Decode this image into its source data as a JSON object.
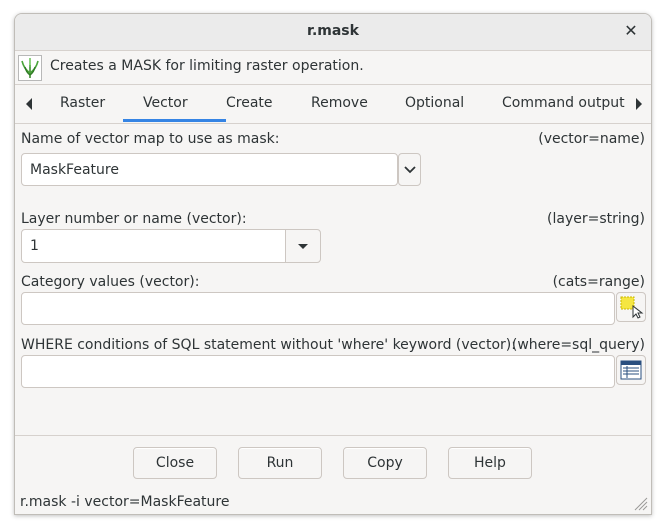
{
  "window": {
    "title": "r.mask",
    "close_glyph": "✕"
  },
  "description": {
    "text": "Creates a MASK for limiting raster operation.",
    "logo_icon": "grass-logo-icon"
  },
  "tabs": [
    {
      "label": "Raster",
      "active": false
    },
    {
      "label": "Vector",
      "active": true
    },
    {
      "label": "Create",
      "active": false
    },
    {
      "label": "Remove",
      "active": false
    },
    {
      "label": "Optional",
      "active": false
    },
    {
      "label": "Command output",
      "active": false
    }
  ],
  "accent_color": "#3584e4",
  "fields": {
    "vector": {
      "label": "Name of vector map to use as mask:",
      "param": "(vector=name)",
      "value": "MaskFeature"
    },
    "layer": {
      "label": "Layer number or name (vector):",
      "param": "(layer=string)",
      "value": "1"
    },
    "cats": {
      "label": "Category values (vector):",
      "param": "(cats=range)",
      "value": "",
      "button_icon": "select-from-map-icon"
    },
    "where": {
      "label": "WHERE conditions of SQL statement without 'where' keyword (vector):",
      "param": "(where=sql_query)",
      "value": "",
      "button_icon": "sql-builder-icon"
    }
  },
  "buttons": {
    "close": "Close",
    "run": "Run",
    "copy": "Copy",
    "help": "Help"
  },
  "status_command": "r.mask -i vector=MaskFeature"
}
